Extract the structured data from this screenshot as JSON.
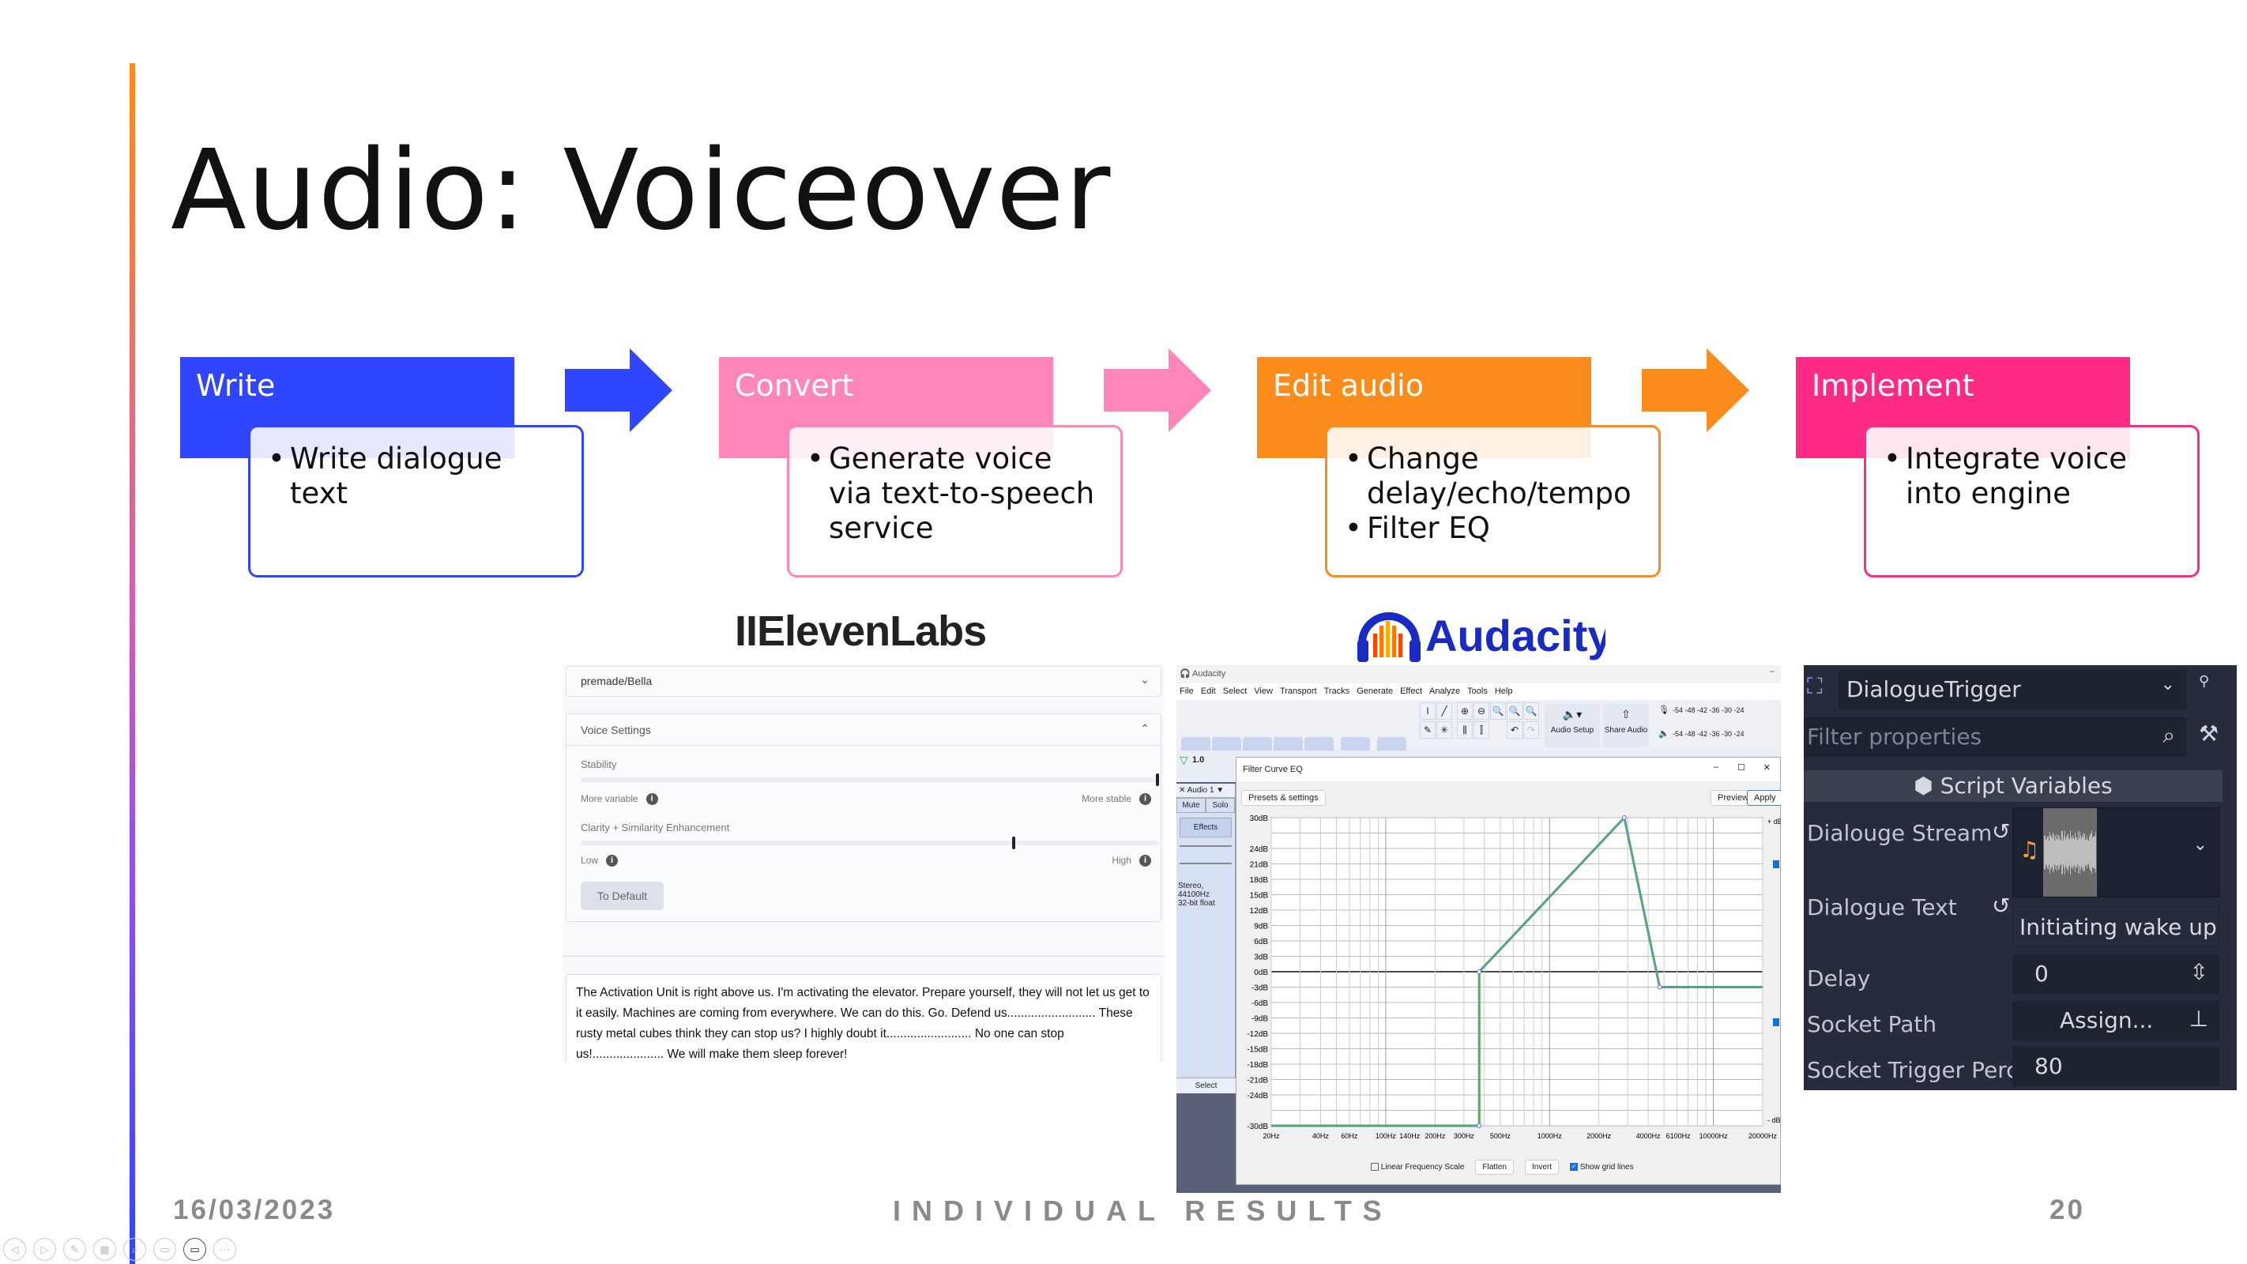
{
  "slide": {
    "title": "Audio: Voiceover",
    "date": "16/03/2023",
    "section": "INDIVIDUAL RESULTS",
    "page_number": "20"
  },
  "colors": {
    "write": "#2f45ff",
    "convert": "#ff86b8",
    "edit": "#fb8c1c",
    "implement": "#ff2a84"
  },
  "steps": [
    {
      "header": "Write",
      "bullets": [
        "Write dialogue text"
      ]
    },
    {
      "header": "Convert",
      "bullets": [
        "Generate voice via text-to-speech service"
      ]
    },
    {
      "header": "Edit audio",
      "bullets": [
        "Change delay/echo/tempo",
        "Filter EQ"
      ]
    },
    {
      "header": "Implement",
      "bullets": [
        "Integrate voice into engine"
      ]
    }
  ],
  "elevenlabs": {
    "logo": "IIElevenLabs",
    "voice": "premade/Bella",
    "voice_settings": "Voice Settings",
    "stability_label": "Stability",
    "stability_value": 1.0,
    "more_variable": "More variable",
    "more_stable": "More stable",
    "clarity_label": "Clarity + Similarity Enhancement",
    "clarity_value": 0.75,
    "low": "Low",
    "high": "High",
    "to_default": "To Default",
    "text": "The Activation Unit is right above us. I'm activating the elevator. Prepare yourself, they will not let us get to it easily. Machines are coming from everywhere. We can do this. Go. Defend us.......................... These rusty metal cubes think they can stop us? I highly doubt it......................... No one can stop us!..................... We will make them sleep forever!"
  },
  "audacity": {
    "logo": "Audacity",
    "window_title": "Audacity",
    "menu": [
      "File",
      "Edit",
      "Select",
      "View",
      "Transport",
      "Tracks",
      "Generate",
      "Effect",
      "Analyze",
      "Tools",
      "Help"
    ],
    "audio_setup": "Audio Setup",
    "share_audio": "Share Audio",
    "meter_ticks": "-54 -48 -42 -36 -30 -24",
    "ruler": "1.0",
    "track": {
      "name": "Audio 1",
      "mute": "Mute",
      "solo": "Solo",
      "effects": "Effects",
      "format1": "Stereo, 44100Hz",
      "format2": "32-bit float",
      "select": "Select"
    },
    "dialog": {
      "title": "Filter Curve EQ",
      "presets": "Presets & settings",
      "preview": "Preview",
      "apply": "Apply",
      "plus_db": "+ dB",
      "minus_db": "- dB",
      "linear": "Linear Frequency Scale",
      "flatten": "Flatten",
      "invert": "Invert",
      "grid": "Show grid lines",
      "grid_checked": true,
      "linear_checked": false
    },
    "eq": {
      "db_ticks": [
        30,
        24,
        21,
        18,
        15,
        12,
        9,
        6,
        3,
        0,
        -3,
        -6,
        -9,
        -12,
        -15,
        -18,
        -21,
        -24,
        -30
      ],
      "freq_ticks": [
        20,
        40,
        60,
        100,
        140,
        200,
        300,
        500,
        1000,
        2000,
        4000,
        6100,
        10000,
        20000
      ],
      "curve_hz": [
        20,
        372,
        372,
        2860,
        4700,
        20000
      ],
      "curve_db": [
        -30,
        -30,
        0,
        30,
        -3,
        -3
      ],
      "ylim": [
        -30,
        30
      ],
      "xlim": [
        20,
        20000
      ],
      "xscale": "log"
    }
  },
  "godot": {
    "node": "DialogueTrigger",
    "filter_placeholder": "Filter properties",
    "section": "Script Variables",
    "props": [
      {
        "label": "Dialouge Stream"
      },
      {
        "label": "Dialogue Text",
        "value": "Initiating wake up"
      },
      {
        "label": "Delay",
        "value": "0"
      },
      {
        "label": "Socket Path",
        "value": "Assign..."
      },
      {
        "label": "Socket Trigger Perc",
        "value": "80"
      }
    ]
  }
}
